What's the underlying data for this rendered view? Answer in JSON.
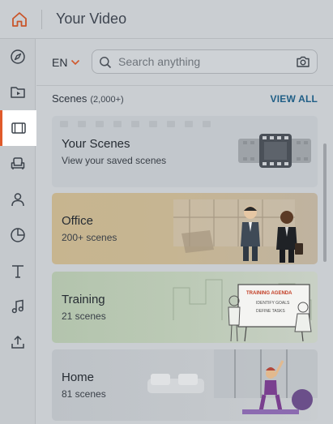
{
  "header": {
    "title": "Your Video",
    "home_icon": "home-icon"
  },
  "rail": {
    "items": [
      {
        "name": "explore",
        "icon": "compass-icon"
      },
      {
        "name": "media",
        "icon": "folder-video-icon"
      },
      {
        "name": "scenes",
        "icon": "film-icon",
        "active": true
      },
      {
        "name": "props",
        "icon": "armchair-icon"
      },
      {
        "name": "characters",
        "icon": "person-icon"
      },
      {
        "name": "charts",
        "icon": "pie-chart-icon"
      },
      {
        "name": "text",
        "icon": "text-icon"
      },
      {
        "name": "audio",
        "icon": "music-icon"
      },
      {
        "name": "upload",
        "icon": "upload-icon"
      }
    ],
    "accent": "#e05a2b"
  },
  "toolbar": {
    "language": "EN",
    "search_placeholder": "Search anything"
  },
  "section": {
    "title": "Scenes",
    "count": "(2,000+)",
    "view_all": "VIEW ALL"
  },
  "cards": [
    {
      "title": "Your Scenes",
      "subtitle": "View your saved scenes"
    },
    {
      "title": "Office",
      "subtitle": "200+ scenes"
    },
    {
      "title": "Training",
      "subtitle": "21 scenes",
      "board_title": "TRAINING AGENDA",
      "board_items": [
        "IDENTIFY GOALS",
        "DEFINE TASKS"
      ]
    },
    {
      "title": "Home",
      "subtitle": "81 scenes"
    }
  ]
}
